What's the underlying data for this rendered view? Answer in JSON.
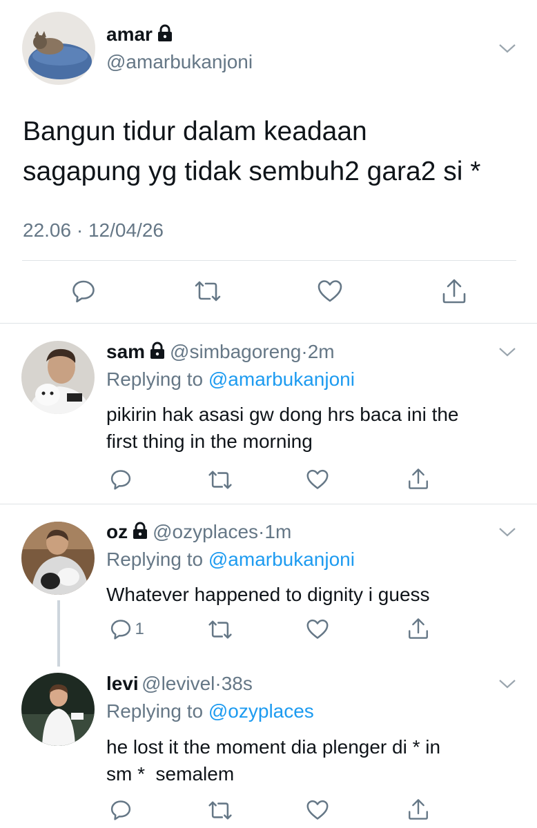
{
  "main_tweet": {
    "name": "amar",
    "handle": "@amarbukanjoni",
    "text_line1": "Bangun tidur dalam keadaan",
    "text_line2": "sagapung yg tidak sembuh2 gara2 si *",
    "time": "22.06",
    "date": "12/04/26"
  },
  "replies": [
    {
      "name": "sam",
      "handle": "@simbagoreng",
      "time": "2m",
      "replying_prefix": "Replying to",
      "replying_to": "@amarbukanjoni",
      "text_line1": "pikirin hak asasi gw dong hrs baca ini the",
      "text_line2": "first thing in the morning"
    },
    {
      "name": "oz",
      "handle": "@ozyplaces",
      "time": "1m",
      "replying_prefix": "Replying to",
      "replying_to": "@amarbukanjoni",
      "text_line1": "Whatever happened to dignity i guess",
      "reply_count": "1"
    },
    {
      "name": "levi",
      "handle": "@levivel",
      "time": "38s",
      "replying_prefix": "Replying to",
      "replying_to": "@ozyplaces",
      "text_line1": "he lost it the moment dia plenger di * in",
      "text_line2": "sm *  semalem"
    }
  ],
  "separator": "·",
  "icons": [
    "reply-icon",
    "retweet-icon",
    "like-icon",
    "share-icon",
    "lock-icon",
    "chevron-down-icon"
  ],
  "colors": {
    "link": "#1d9bf0",
    "secondary": "#657786",
    "text": "#0f1419",
    "divider": "#dfe3e6"
  }
}
